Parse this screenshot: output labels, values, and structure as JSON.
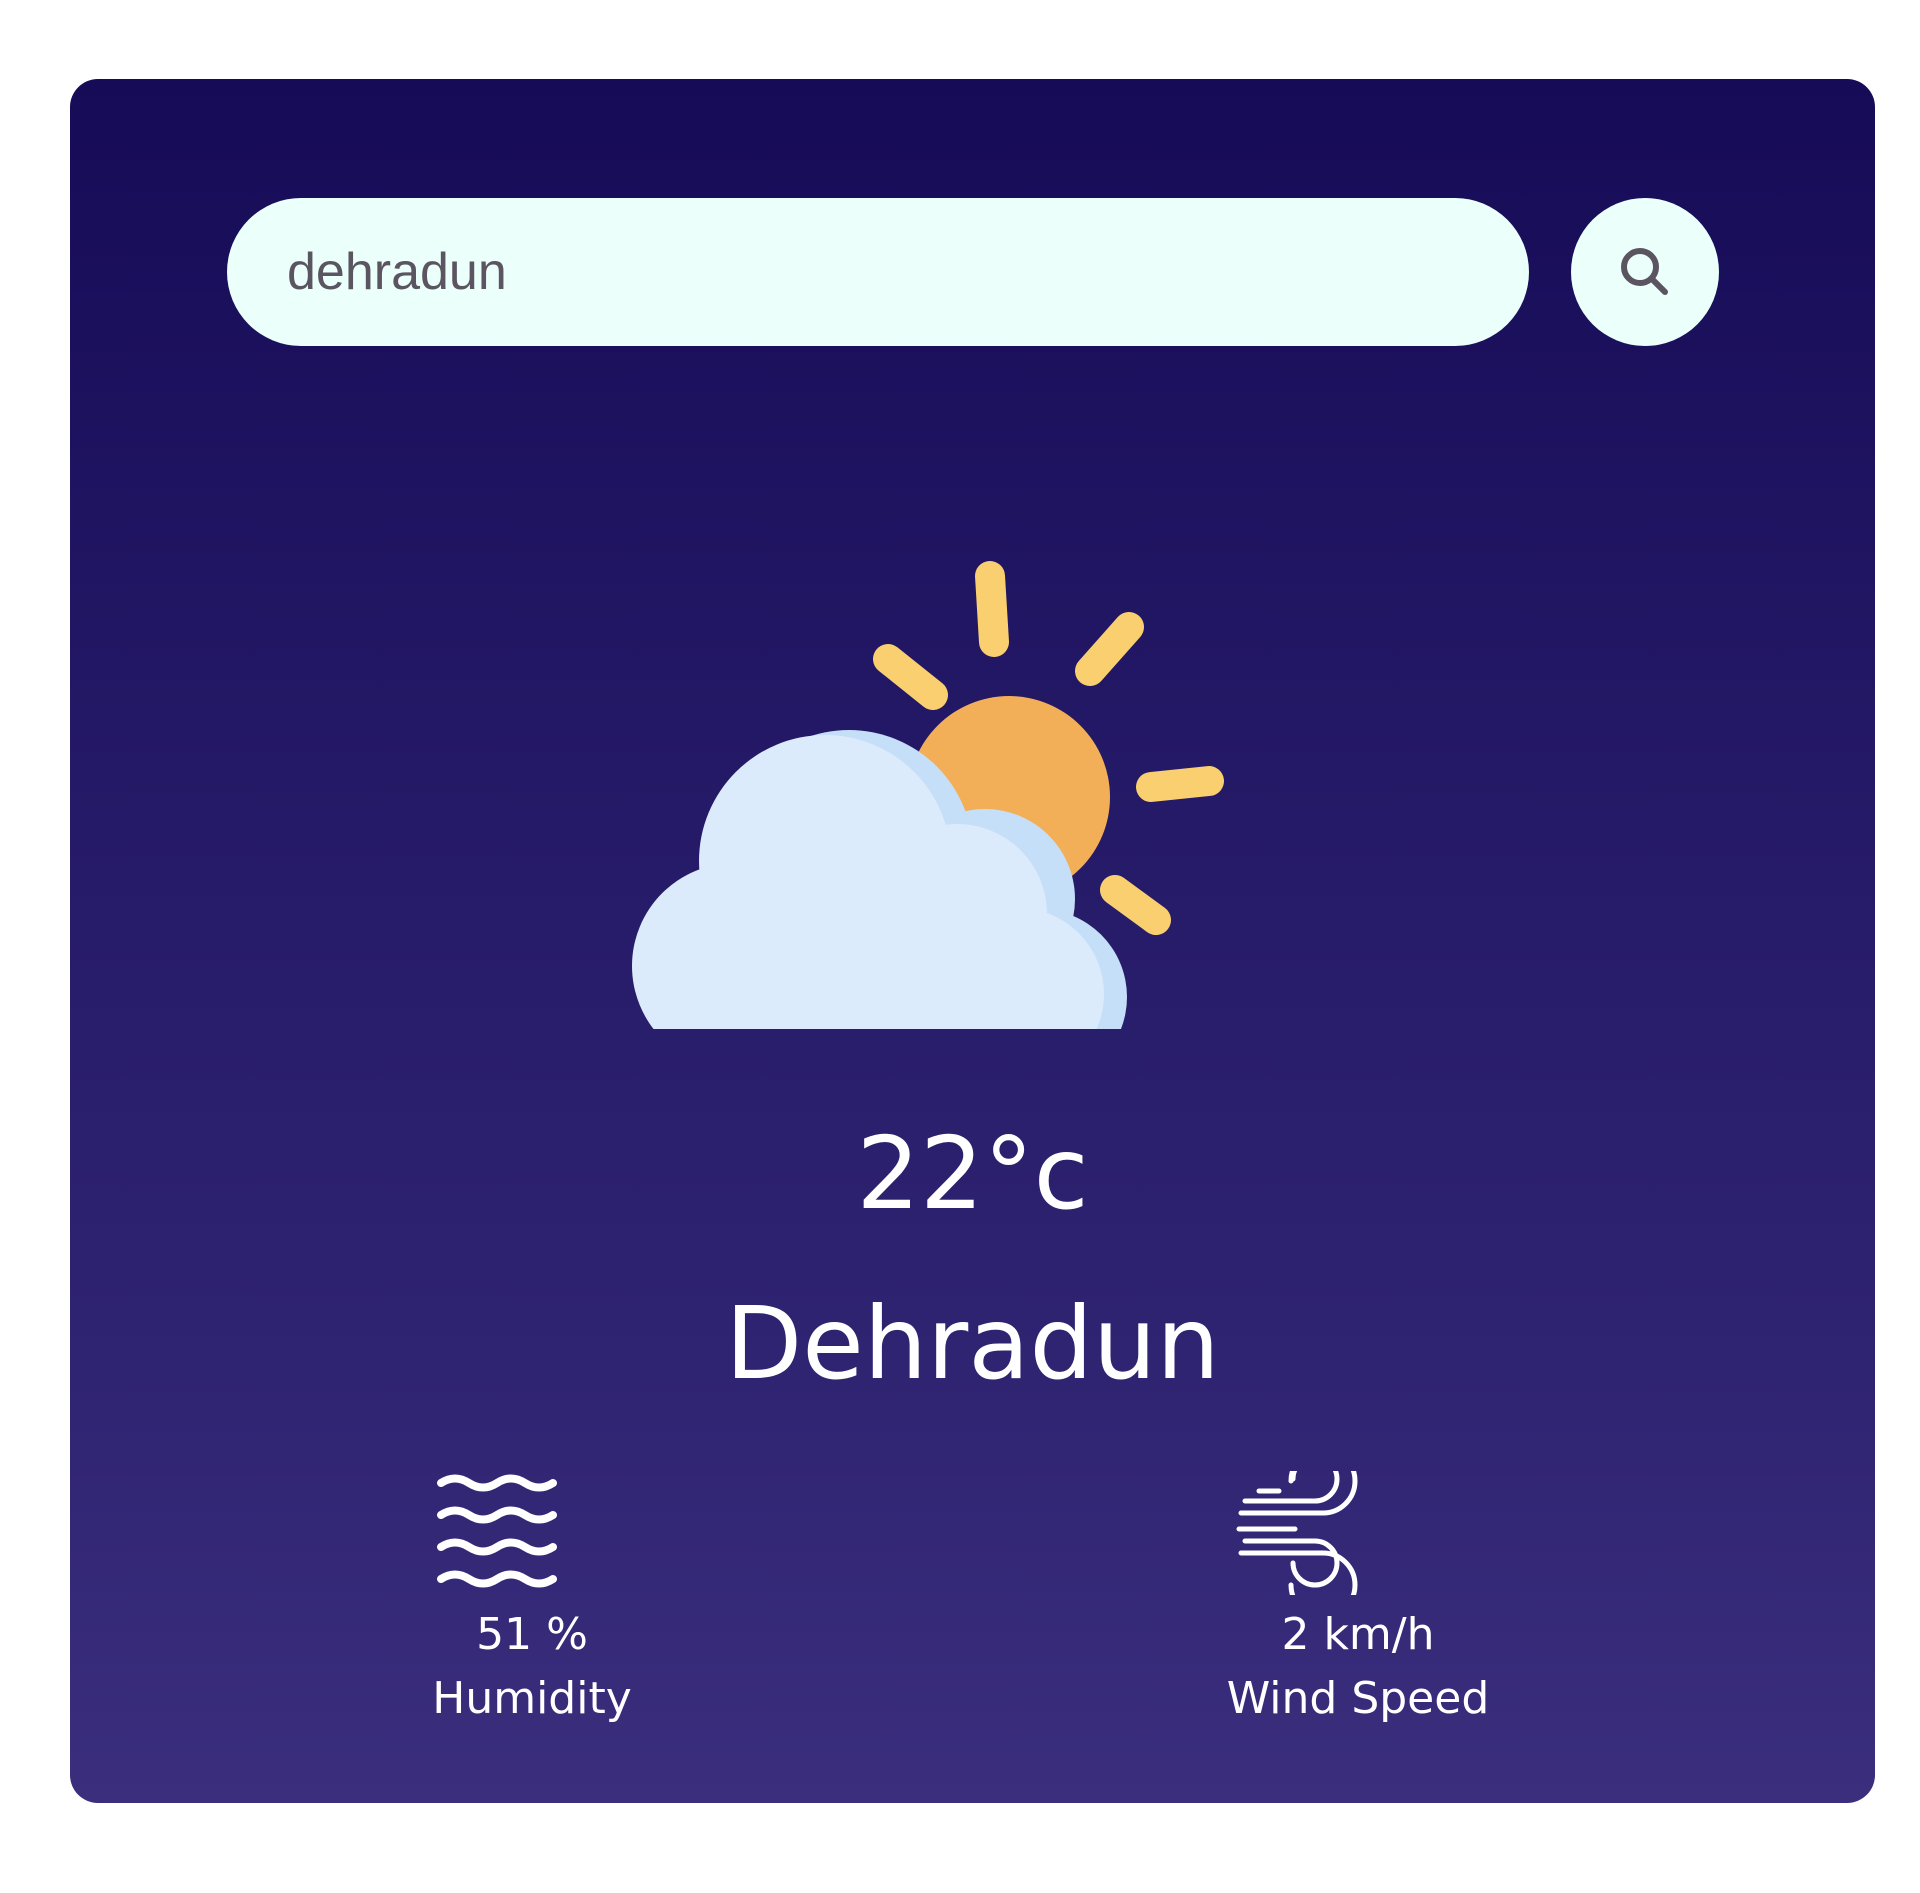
{
  "search": {
    "value": "dehradun"
  },
  "icons": {
    "search_button": "search-icon",
    "weather": "partly-cloudy-icon",
    "humidity": "humidity-waves-icon",
    "wind": "wind-icon"
  },
  "weather": {
    "temperature": "22°c",
    "city": "Dehradun"
  },
  "stats": {
    "humidity": {
      "value": "51 %",
      "label": "Humidity"
    },
    "wind": {
      "value": "2 km/h",
      "label": "Wind Speed"
    }
  },
  "colors": {
    "card_top": "#160b57",
    "card_bottom": "#3a2e7d",
    "input_bg": "#ebfffb",
    "sun": "#f3af58",
    "sun_rays": "#f9cf6f",
    "cloud": "#dbebfb",
    "cloud_shadow": "#c6dff8",
    "text": "#ffffff"
  }
}
